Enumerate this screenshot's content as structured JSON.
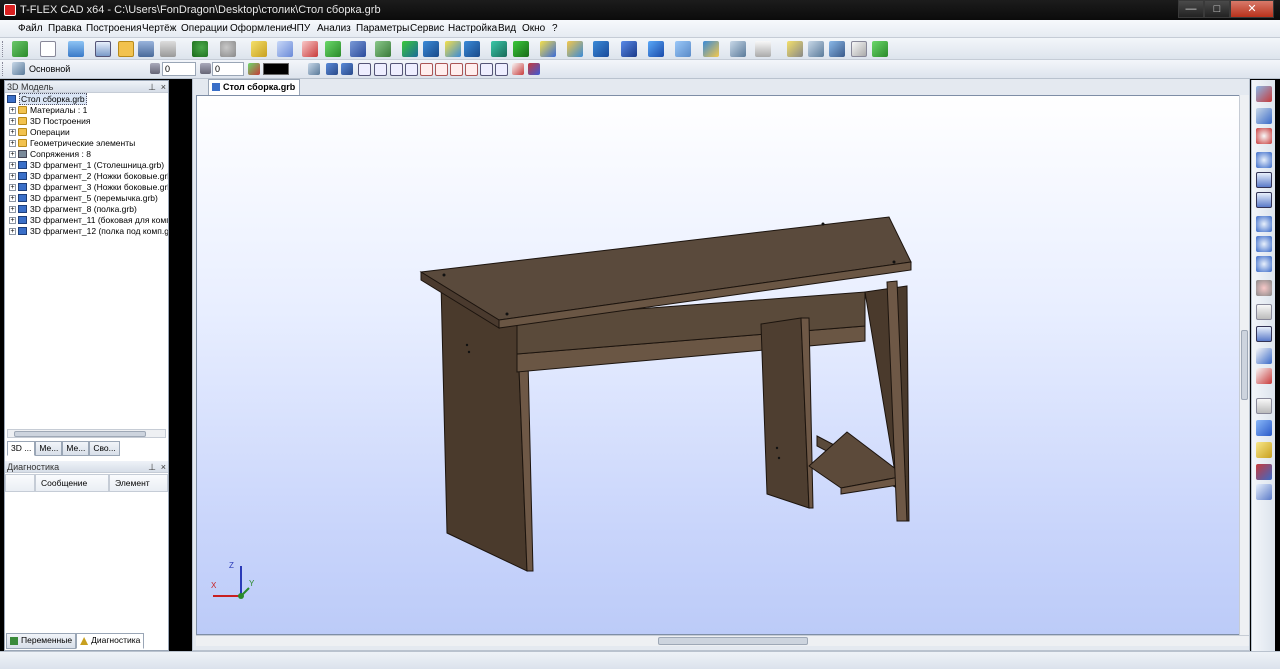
{
  "window": {
    "title": "T-FLEX CAD x64 - C:\\Users\\FonDragon\\Desktop\\столик\\Стол сборка.grb",
    "minimize": "—",
    "maximize": "□",
    "close": "✕"
  },
  "menu": [
    "Файл",
    "Правка",
    "Построения",
    "Чертёж",
    "Операции",
    "Оформление",
    "ЧПУ",
    "Анализ",
    "Параметры",
    "Сервис",
    "Настройка",
    "Вид",
    "Окно",
    "?"
  ],
  "toolbar2": {
    "layer_label": "Основной",
    "field1_value": "0",
    "field2_value": "0"
  },
  "model_panel": {
    "title": "3D Модель",
    "pin": "⊥",
    "close": "×",
    "root": "Стол сборка.grb",
    "items": [
      {
        "label": "Материалы : 1",
        "icon": "folder-icon"
      },
      {
        "label": "3D Построения",
        "icon": "folder-icon"
      },
      {
        "label": "Операции",
        "icon": "folder-icon"
      },
      {
        "label": "Геометрические элементы",
        "icon": "folder-icon"
      },
      {
        "label": "Сопряжения : 8",
        "icon": "mate-icon"
      },
      {
        "label": "3D фрагмент_1 (Столешница.grb)",
        "icon": "fragment-icon"
      },
      {
        "label": "3D фрагмент_2 (Ножки боковые.grb)",
        "icon": "fragment-icon"
      },
      {
        "label": "3D фрагмент_3 (Ножки боковые.grb)",
        "icon": "fragment-icon"
      },
      {
        "label": "3D фрагмент_5 (перемычка.grb)",
        "icon": "fragment-icon"
      },
      {
        "label": "3D фрагмент_8 (полка.grb)",
        "icon": "fragment-icon"
      },
      {
        "label": "3D фрагмент_11 (боковая для компа.g",
        "icon": "fragment-icon"
      },
      {
        "label": "3D фрагмент_12 (полка под комп.grb)",
        "icon": "fragment-icon"
      }
    ],
    "tabs": [
      "3D ...",
      "Ме...",
      "Ме...",
      "Сво..."
    ]
  },
  "diagnostics_panel": {
    "title": "Диагностика",
    "col_message": "Сообщение",
    "col_element": "Элемент"
  },
  "bottom_tabs": [
    "Переменные",
    "Диагностика"
  ],
  "document": {
    "tab_label": "Стол сборка.grb"
  },
  "axes": {
    "z": "Z",
    "y": "Y",
    "x": "X"
  },
  "colors": {
    "wood_top": "#5a4a3c",
    "wood_side": "#4a3b2e",
    "wood_front": "#6a5644",
    "viewport_bottom": "#bccbf8"
  }
}
